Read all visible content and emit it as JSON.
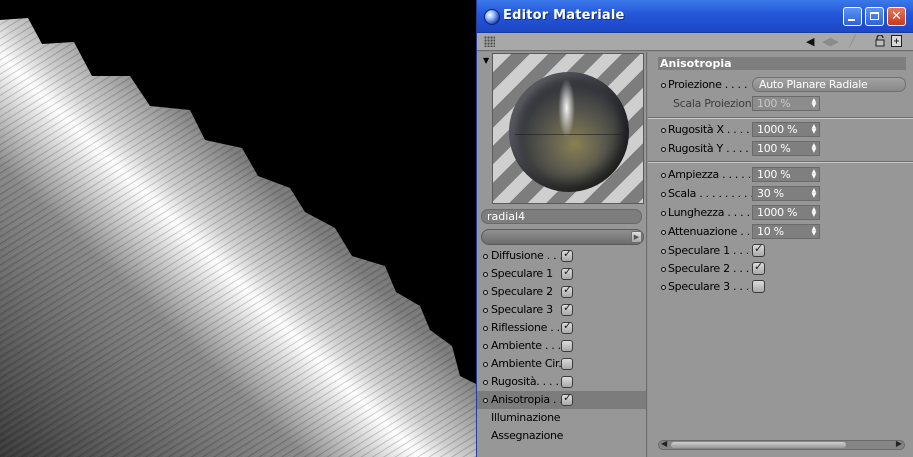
{
  "window": {
    "title": "Editor Materiale",
    "buttons": {
      "minimize": "minimize-icon",
      "maximize": "maximize-icon",
      "close": "close-icon"
    }
  },
  "toolbar": {
    "icons": [
      "grip-icon",
      "back-arrow-icon",
      "forward-arrow-icon",
      "lock-icon",
      "new-window-icon"
    ]
  },
  "material": {
    "name": "radial4",
    "channels": [
      {
        "label": "Diffusione . . .",
        "checked": true
      },
      {
        "label": "Speculare 1",
        "checked": true
      },
      {
        "label": "Speculare 2",
        "checked": true
      },
      {
        "label": "Speculare 3",
        "checked": true
      },
      {
        "label": "Riflessione . .",
        "checked": true
      },
      {
        "label": "Ambiente . . .",
        "checked": false
      },
      {
        "label": "Ambiente Cir.",
        "checked": false
      },
      {
        "label": "Rugosità. . . .",
        "checked": false
      },
      {
        "label": "Anisotropia . .",
        "checked": true,
        "active": true
      }
    ],
    "extra": [
      "Illuminazione",
      "Assegnazione"
    ]
  },
  "panel": {
    "title": "Anisotropia",
    "proiezione": {
      "label": "Proiezione . . . .",
      "value": "Auto Planare Radiale"
    },
    "scala_proiezione": {
      "label": "Scala Proiezione",
      "value": "100 %"
    },
    "rugosita_x": {
      "label": "Rugosità X . . . .",
      "value": "1000 %"
    },
    "rugosita_y": {
      "label": "Rugosità Y . . . .",
      "value": "100 %"
    },
    "ampiezza": {
      "label": "Ampiezza . . . . . .",
      "value": "100 %"
    },
    "scala": {
      "label": "Scala . . . . . . . . .",
      "value": "30 %"
    },
    "lunghezza": {
      "label": "Lunghezza . . . .",
      "value": "1000 %"
    },
    "attenuazione": {
      "label": "Attenuazione . .",
      "value": "10 %"
    },
    "speculare1": {
      "label": "Speculare 1 . . . .",
      "checked": true
    },
    "speculare2": {
      "label": "Speculare 2 . . . .",
      "checked": true
    },
    "speculare3": {
      "label": "Speculare 3 . . . .",
      "checked": false
    }
  },
  "colors": {
    "titlebar": "#2456d8",
    "panel_bg": "#979797",
    "header_bg": "#7e7e7e",
    "field_bg": "#7f7f7f"
  }
}
